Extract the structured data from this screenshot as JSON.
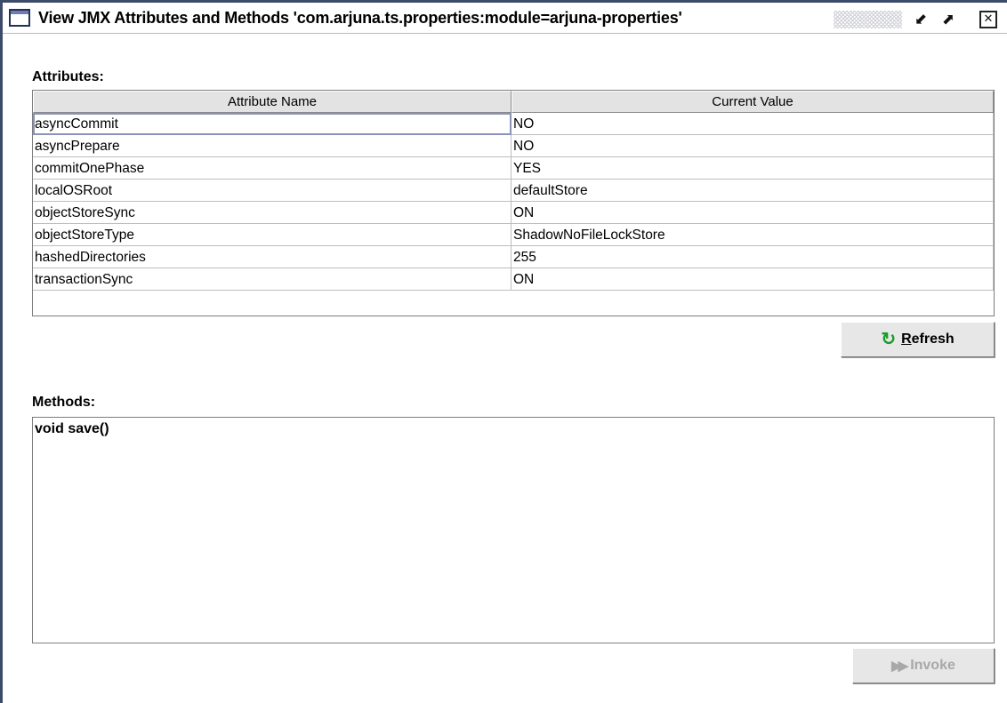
{
  "window": {
    "title": "View JMX Attributes and Methods 'com.arjuna.ts.properties:module=arjuna-properties'",
    "controls": {
      "minimize_icon": "minimize-icon",
      "maximize_icon": "maximize-icon",
      "close_icon": "close-icon"
    }
  },
  "attributes": {
    "label": "Attributes:",
    "columns": [
      "Attribute Name",
      "Current Value"
    ],
    "rows": [
      {
        "name": "asyncCommit",
        "value": "NO"
      },
      {
        "name": "asyncPrepare",
        "value": "NO"
      },
      {
        "name": "commitOnePhase",
        "value": "YES"
      },
      {
        "name": "localOSRoot",
        "value": "defaultStore"
      },
      {
        "name": "objectStoreSync",
        "value": "ON"
      },
      {
        "name": "objectStoreType",
        "value": "ShadowNoFileLockStore"
      },
      {
        "name": "hashedDirectories",
        "value": "255"
      },
      {
        "name": "transactionSync",
        "value": "ON"
      }
    ],
    "selected_row": 0,
    "refresh_button": {
      "mnemonic": "R",
      "label_rest": "efresh",
      "icon": "refresh-icon"
    }
  },
  "methods": {
    "label": "Methods:",
    "items": [
      "void save()"
    ],
    "invoke_button": {
      "label": "Invoke",
      "icon": "invoke-icon",
      "enabled": false
    }
  },
  "colors": {
    "window_border": "#3e4a6a",
    "refresh_icon": "#1a9c2b",
    "disabled_text": "#a8a8a8"
  }
}
